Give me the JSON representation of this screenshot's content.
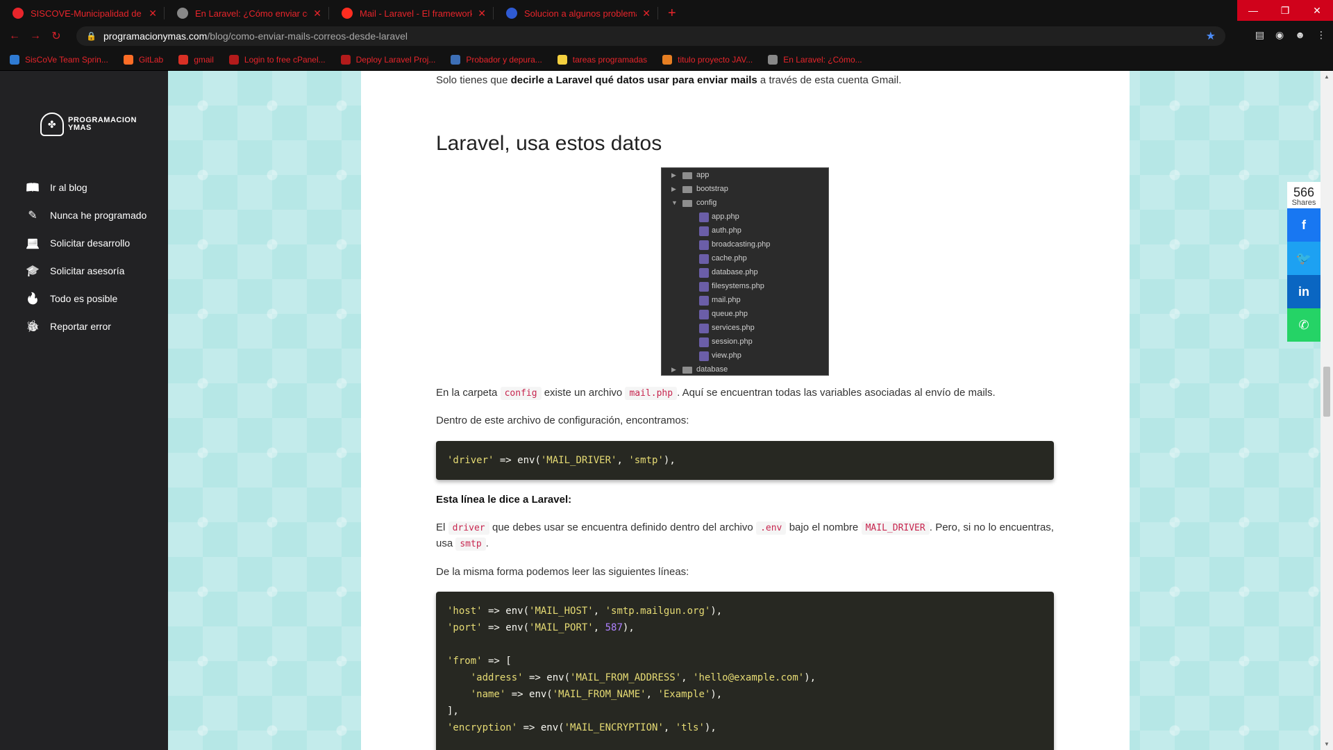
{
  "browser": {
    "tabs": [
      {
        "title": "SISCOVE-Municipalidad de Nico",
        "color": "#e8252b"
      },
      {
        "title": "En Laravel: ¿Cómo enviar correo",
        "color": "#888888"
      },
      {
        "title": "Mail - Laravel - El framework PH",
        "color": "#ff2d20"
      },
      {
        "title": "Solucion a algunos problemas re",
        "color": "#2f5bd3"
      }
    ],
    "new_tab": "+",
    "url_host": "programacionymas.com",
    "url_path": "/blog/como-enviar-mails-correos-desde-laravel",
    "bookmarks": [
      {
        "label": "SisCoVe Team Sprin...",
        "color": "#2f7bd3"
      },
      {
        "label": "GitLab",
        "color": "#fc6d26"
      },
      {
        "label": "gmail",
        "color": "#d93025"
      },
      {
        "label": "Login to free cPanel...",
        "color": "#b31b1b"
      },
      {
        "label": "Deploy Laravel Proj...",
        "color": "#b31b1b"
      },
      {
        "label": "Probador y depura...",
        "color": "#3d6fb6"
      },
      {
        "label": "tareas programadas",
        "color": "#f4d03f"
      },
      {
        "label": "titulo proyecto JAV...",
        "color": "#e67e22"
      },
      {
        "label": "En Laravel: ¿Cómo...",
        "color": "#888888"
      }
    ]
  },
  "sidebar": {
    "logo_text": "PROGRAMACION\nYMAS",
    "items": [
      {
        "label": "Ir al blog",
        "icon": "book-icon"
      },
      {
        "label": "Nunca he programado",
        "icon": "magic-wand-icon"
      },
      {
        "label": "Solicitar desarrollo",
        "icon": "laptop-icon"
      },
      {
        "label": "Solicitar asesoría",
        "icon": "graduation-cap-icon"
      },
      {
        "label": "Todo es posible",
        "icon": "flame-icon"
      },
      {
        "label": "Reportar error",
        "icon": "bug-icon"
      }
    ]
  },
  "article": {
    "intro_prefix": "Solo tienes que ",
    "intro_bold": "decirle a Laravel qué datos usar para enviar mails",
    "intro_suffix": " a través de esta cuenta Gmail.",
    "heading": "Laravel, usa estos datos",
    "tree": {
      "folders_top": [
        "app",
        "bootstrap"
      ],
      "open_folder": "config",
      "files": [
        "app.php",
        "auth.php",
        "broadcasting.php",
        "cache.php",
        "database.php",
        "filesystems.php",
        "mail.php",
        "queue.php",
        "services.php",
        "session.php",
        "view.php"
      ],
      "folders_bottom": [
        "database"
      ]
    },
    "p1_a": "En la carpeta ",
    "p1_code1": "config",
    "p1_b": " existe un archivo ",
    "p1_code2": "mail.php",
    "p1_c": ". Aquí se encuentran todas las variables asociadas al envío de mails.",
    "p2": "Dentro de este archivo de configuración, encontramos:",
    "p3_bold": "Esta línea le dice a Laravel:",
    "p4_a": "El ",
    "p4_code1": "driver",
    "p4_b": " que debes usar se encuentra definido dentro del archivo ",
    "p4_code2": ".env",
    "p4_c": " bajo el nombre ",
    "p4_code3": "MAIL_DRIVER",
    "p4_d": ". Pero, si no lo encuentras, usa ",
    "p4_code4": "smtp",
    "p4_e": ".",
    "p5": "De la misma forma podemos leer las siguientes líneas:"
  },
  "share": {
    "count": "566",
    "label": "Shares",
    "buttons": [
      {
        "name": "facebook",
        "icon": "facebook-icon",
        "glyph": "f"
      },
      {
        "name": "twitter",
        "icon": "twitter-icon",
        "glyph": "🐦"
      },
      {
        "name": "linkedin",
        "icon": "linkedin-icon",
        "glyph": "in"
      },
      {
        "name": "whatsapp",
        "icon": "whatsapp-icon",
        "glyph": "✆"
      }
    ]
  }
}
